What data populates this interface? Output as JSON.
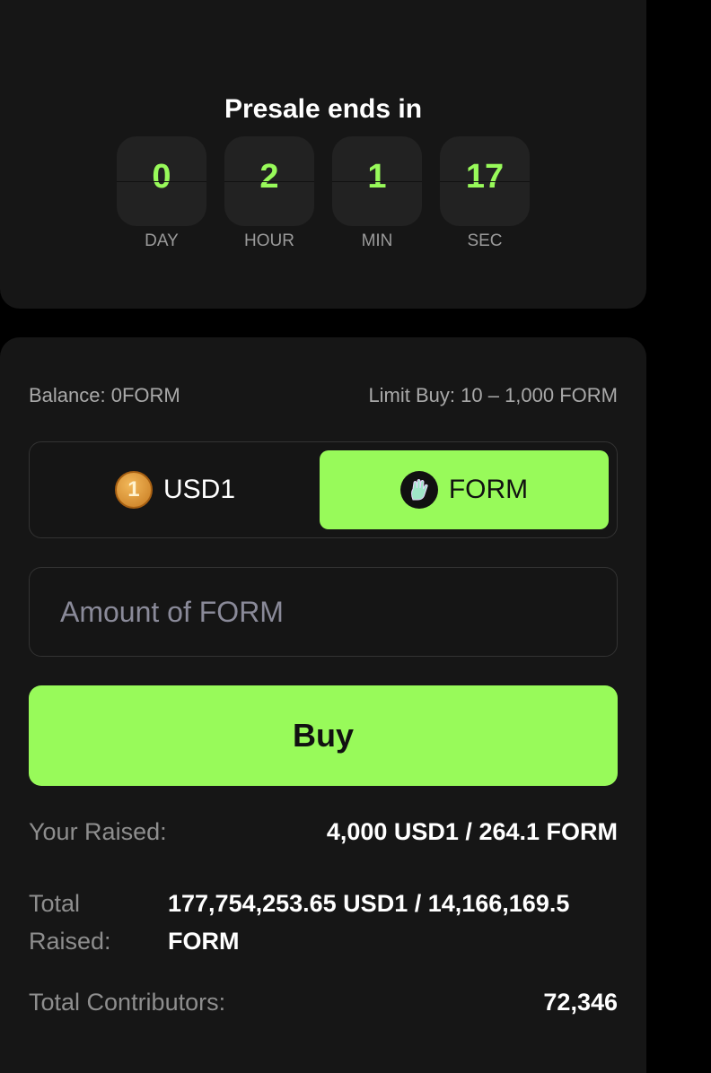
{
  "countdown": {
    "title": "Presale ends in",
    "units": [
      {
        "value": "0",
        "label": "DAY"
      },
      {
        "value": "2",
        "label": "HOUR"
      },
      {
        "value": "1",
        "label": "MIN"
      },
      {
        "value": "17",
        "label": "SEC"
      }
    ]
  },
  "purchase": {
    "balance": "Balance: 0FORM",
    "limit": "Limit Buy: 10 – 1,000 FORM",
    "currency_options": [
      {
        "label": "USD1",
        "icon": "usd1-coin-icon"
      },
      {
        "label": "FORM",
        "icon": "form-token-icon",
        "selected": true
      }
    ],
    "amount_placeholder": "Amount of FORM",
    "buy_label": "Buy"
  },
  "stats": {
    "your_raised_label": "Your Raised:",
    "your_raised_value": "4,000 USD1 / 264.1 FORM",
    "total_raised_label": "Total Raised:",
    "total_raised_value": "177,754,253.65 USD1 / 14,166,169.5 FORM",
    "total_contributors_label": "Total Contributors:",
    "total_contributors_value": "72,346"
  },
  "colors": {
    "accent": "#98fa5a",
    "panel": "#161616",
    "background": "#000000"
  }
}
